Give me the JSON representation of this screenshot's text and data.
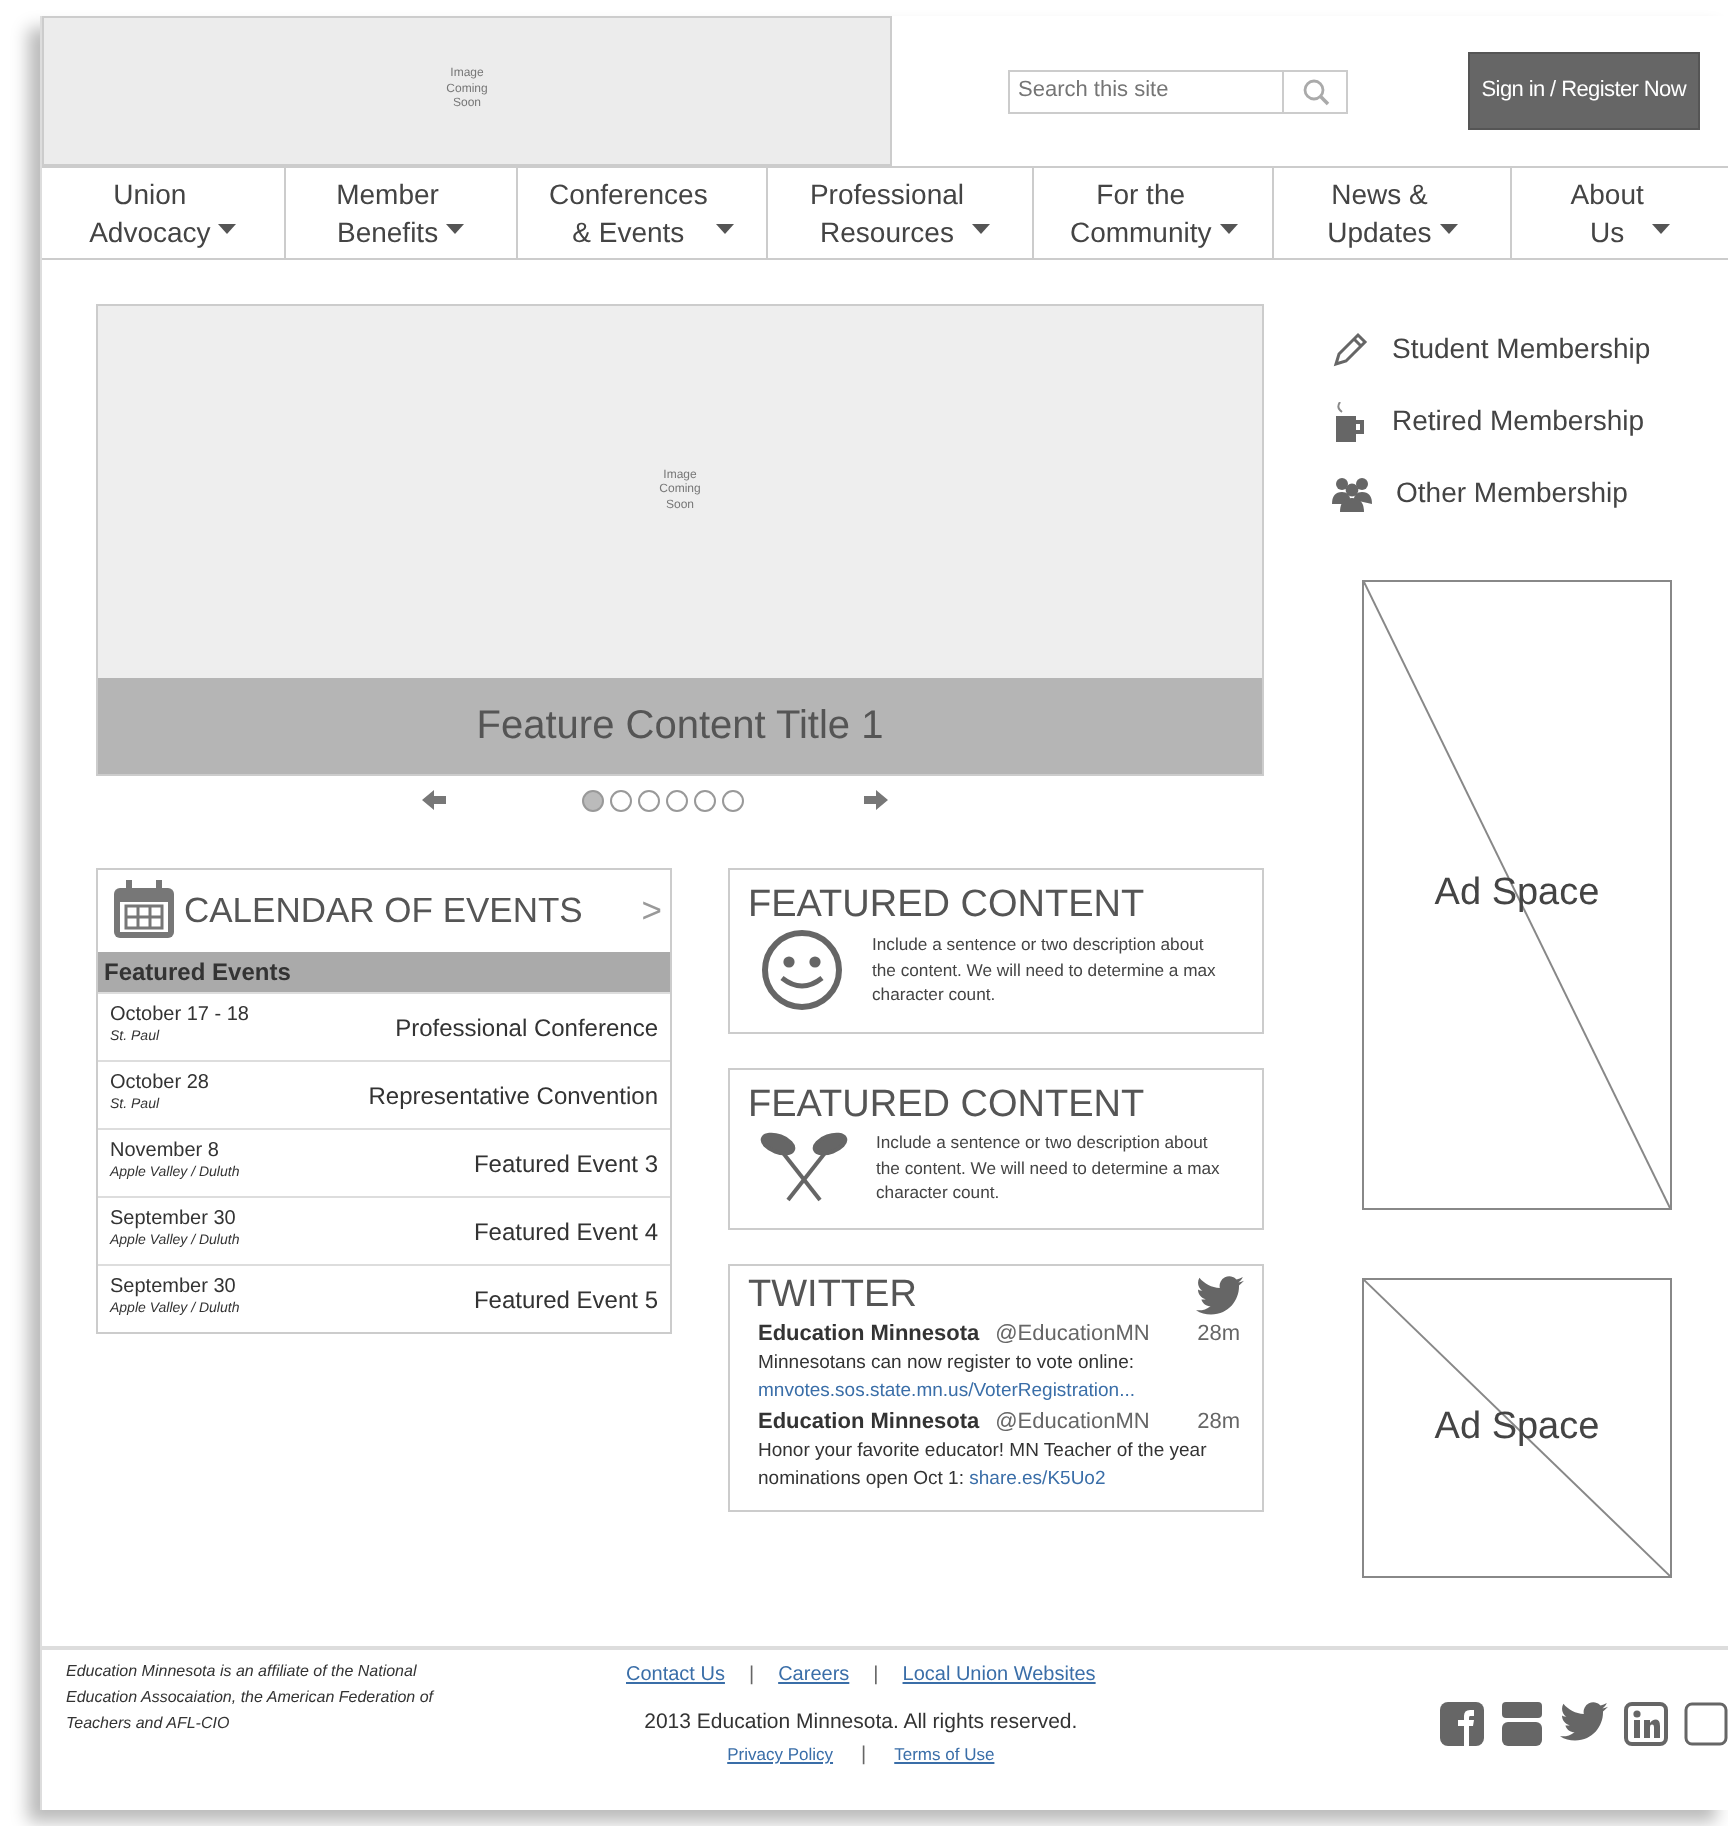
{
  "header": {
    "logo_placeholder": "Image Coming Soon",
    "search": {
      "placeholder": "Search this site"
    },
    "sign_in_button": "Sign in / Register Now"
  },
  "nav": [
    {
      "lines": [
        "Union",
        "Advocacy"
      ]
    },
    {
      "lines": [
        "Member",
        "Benefits"
      ]
    },
    {
      "lines": [
        "Conferences",
        "& Events"
      ]
    },
    {
      "lines": [
        "Professional",
        "Resources"
      ]
    },
    {
      "lines": [
        "For the",
        "Community"
      ]
    },
    {
      "lines": [
        "News &",
        "Updates"
      ]
    },
    {
      "lines": [
        "About",
        "Us"
      ]
    }
  ],
  "carousel": {
    "image_placeholder": "Image Coming Soon",
    "title": "Feature Content Title 1",
    "dots": [
      {
        "selected": true
      },
      {
        "selected": false
      },
      {
        "selected": false
      },
      {
        "selected": false
      },
      {
        "selected": false
      },
      {
        "selected": false
      }
    ]
  },
  "calendar": {
    "title": "CALENDAR OF EVENTS",
    "more": ">",
    "section": "Featured Events",
    "events": [
      {
        "date": "October 17 - 18",
        "location": "St. Paul",
        "title": "Professional Conference"
      },
      {
        "date": "October 28",
        "location": "St. Paul",
        "title": "Representative Convention"
      },
      {
        "date": "November 8",
        "location": "Apple Valley / Duluth",
        "title": "Featured Event 3"
      },
      {
        "date": "September 30",
        "location": "Apple Valley / Duluth",
        "title": "Featured Event 4"
      },
      {
        "date": "September 30",
        "location": "Apple Valley / Duluth",
        "title": "Featured Event 5"
      }
    ]
  },
  "featured": [
    {
      "kind": "smiley",
      "title": "FEATURED CONTENT",
      "text": "Include a sentence or two description about the content. We will need to determine a max character count."
    },
    {
      "kind": "pins",
      "title": "FEATURED CONTENT",
      "text": "Include a sentence or two description about the content. We will need to determine a max character count."
    }
  ],
  "twitter": {
    "title": "TWITTER",
    "tweets": [
      {
        "name": "Education Minnesota",
        "handle": "@EducationMN",
        "time": "28m",
        "text": "Minnesotans can now register to vote online:",
        "link": "mnvotes.sos.state.mn.us/VoterRegistration..."
      },
      {
        "name": "Education Minnesota",
        "handle": "@EducationMN",
        "time": "28m",
        "text": "Honor your favorite educator! MN Teacher of the year nominations open Oct 1:",
        "link": "share.es/K5Uo2"
      }
    ]
  },
  "sidebar": {
    "links": [
      {
        "kind": "pencil",
        "label": "Student Membership"
      },
      {
        "kind": "mug",
        "label": "Retired Membership"
      },
      {
        "kind": "people",
        "label": "Other Membership"
      }
    ],
    "ads": [
      "Ad Space",
      "Ad Space"
    ]
  },
  "footer": {
    "affiliation": "Education Minnesota is an affiliate of the National Education Assocaiation, the American Federation of Teachers and AFL-CIO",
    "links": [
      "Contact Us",
      "Careers",
      "Local Union Websites"
    ],
    "separator": "|",
    "copyright": "2013 Education Minnesota. All rights reserved.",
    "legal_links": [
      "Privacy Policy",
      "Terms of Use"
    ]
  }
}
